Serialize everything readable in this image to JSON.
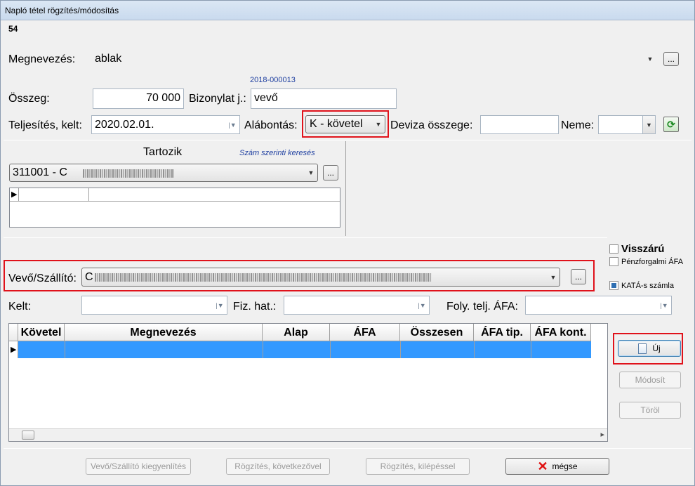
{
  "window": {
    "title": "Napló tétel rögzítés/módosítás"
  },
  "record_number": "54",
  "form": {
    "megnevezes_label": "Megnevezés:",
    "megnevezes_value": "ablak",
    "bizonylat_hint": "2018-000013",
    "osszeg_label": "Összeg:",
    "osszeg_value": "70 000",
    "bizonylat_label": "Bizonylat j.:",
    "bizonylat_value": "vevő",
    "teljesites_label": "Teljesítés, kelt:",
    "teljesites_value": "2020.02.01.",
    "alabontas_label": "Alábontás:",
    "alabontas_value": "K - követel",
    "deviza_label": "Deviza összege:",
    "deviza_value": "",
    "neme_label": "Neme:",
    "neme_value": "",
    "ellipsis": "..."
  },
  "tartozik": {
    "title": "Tartozik",
    "search_link": "Szám szerinti keresés",
    "account_value": "311001 - C",
    "row_marker": "▶"
  },
  "checkboxes": {
    "visszaru": {
      "label": "Visszárú",
      "checked": false
    },
    "penzforgalmi": {
      "label": "Pénzforgalmi ÁFA",
      "checked": false
    },
    "kata": {
      "label": "KATÁ-s számla",
      "checked": true
    }
  },
  "partner": {
    "label": "Vevő/Szállító:",
    "value": "C"
  },
  "dates": {
    "kelt_label": "Kelt:",
    "kelt_value": "",
    "fizhat_label": "Fiz. hat.:",
    "fizhat_value": "",
    "folyteljafa_label": "Foly. telj. ÁFA:",
    "folyteljafa_value": ""
  },
  "table": {
    "columns": [
      "Követel",
      "Megnevezés",
      "Alap",
      "ÁFA",
      "Összesen",
      "ÁFA tip.",
      "ÁFA kont."
    ],
    "row_marker": "▶",
    "scroll_right": "▸"
  },
  "side_buttons": {
    "uj": "Új",
    "modosit": "Módosít",
    "torol": "Töröl"
  },
  "bottom_buttons": {
    "kiegyenlites": "Vevő/Szállító kiegyenlítés",
    "kovetkezovel": "Rögzítés, következővel",
    "kilepessel": "Rögzítés, kilépéssel",
    "megse": "mégse"
  },
  "icons": {
    "dropdown": "▼",
    "combo_pipe": "|▼",
    "refresh": "⟳"
  }
}
